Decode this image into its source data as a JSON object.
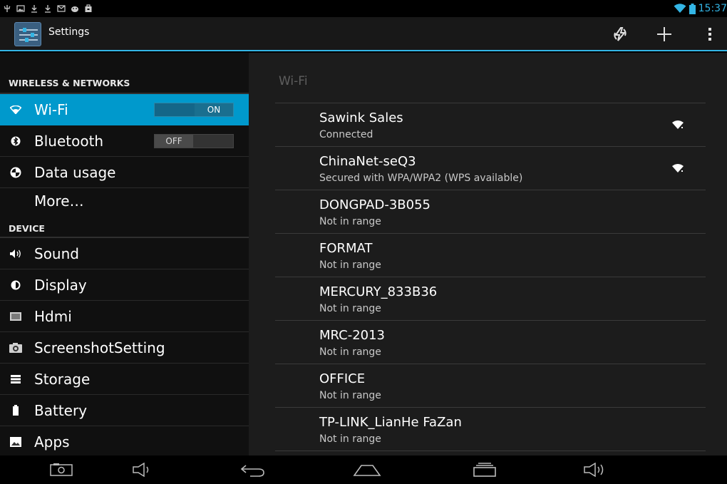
{
  "status_bar": {
    "left_icons": [
      "usb-icon",
      "image-icon",
      "download-icon",
      "download-icon",
      "email-icon",
      "android-icon",
      "bag-icon"
    ],
    "wifi_icon": "wifi-icon",
    "battery_icon": "battery-icon",
    "time": "15:37"
  },
  "action_bar": {
    "app_icon": "settings-icon",
    "title": "Settings",
    "actions": [
      "wps-icon",
      "add-icon",
      "overflow-menu-icon"
    ]
  },
  "sidebar": {
    "categories": {
      "wireless": "WIRELESS & NETWORKS",
      "device": "DEVICE"
    },
    "items": [
      {
        "label": "Wi-Fi",
        "icon": "wifi-icon",
        "toggle": "ON",
        "selected": true
      },
      {
        "label": "Bluetooth",
        "icon": "bluetooth-icon",
        "toggle": "OFF"
      },
      {
        "label": "Data usage",
        "icon": "data-usage-icon"
      },
      {
        "label": "More…"
      },
      {
        "label": "Sound",
        "icon": "speaker-icon"
      },
      {
        "label": "Display",
        "icon": "brightness-icon"
      },
      {
        "label": "Hdmi",
        "icon": "hdmi-icon"
      },
      {
        "label": "ScreenshotSetting",
        "icon": "camera-icon"
      },
      {
        "label": "Storage",
        "icon": "storage-icon"
      },
      {
        "label": "Battery",
        "icon": "battery-icon"
      },
      {
        "label": "Apps",
        "icon": "apps-icon"
      }
    ]
  },
  "wifi_panel": {
    "title": "Wi-Fi",
    "networks": [
      {
        "name": "Sawink Sales",
        "status": "Connected",
        "signal": true
      },
      {
        "name": "ChinaNet-seQ3",
        "status": "Secured with WPA/WPA2 (WPS available)",
        "signal": true
      },
      {
        "name": "DONGPAD-3B055",
        "status": "Not in range",
        "signal": false
      },
      {
        "name": "FORMAT",
        "status": "Not in range",
        "signal": false
      },
      {
        "name": "MERCURY_833B36",
        "status": "Not in range",
        "signal": false
      },
      {
        "name": "MRC-2013",
        "status": "Not in range",
        "signal": false
      },
      {
        "name": "OFFICE",
        "status": "Not in range",
        "signal": false
      },
      {
        "name": "TP-LINK_LianHe FaZan",
        "status": "Not in range",
        "signal": false
      }
    ]
  },
  "nav_bar": {
    "buttons": [
      "screenshot-icon",
      "volume-down-icon",
      "back-icon",
      "home-icon",
      "recent-apps-icon",
      "volume-up-icon"
    ]
  },
  "colors": {
    "accent": "#33b5e5",
    "selected": "#0099cc"
  }
}
